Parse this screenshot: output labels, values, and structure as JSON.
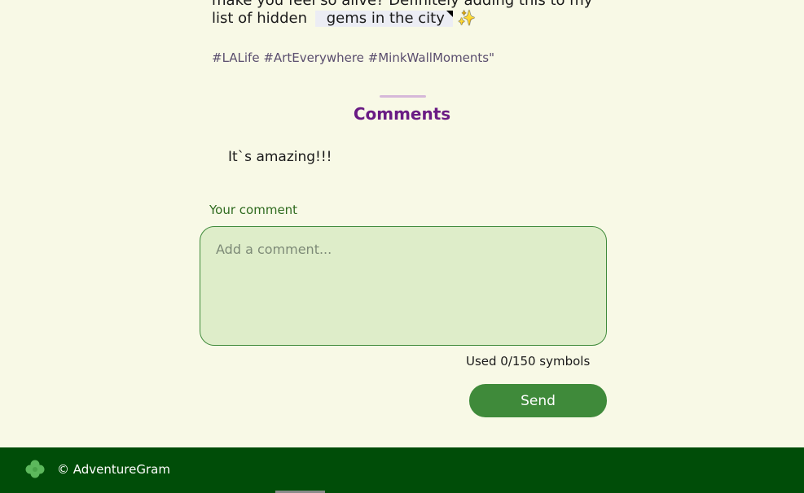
{
  "post": {
    "line1": "make you feel so alive? Definitely adding this to my",
    "line2_prefix": "list of hidden",
    "line2_highlight": "gems in the city",
    "sparkle_icon": "sparkles-icon",
    "hashtags": "#LALife #ArtEverywhere #MinkWallMoments\""
  },
  "comments": {
    "title": "Comments",
    "items": [
      {
        "text": "It`s amazing!!!"
      }
    ]
  },
  "form": {
    "label": "Your comment",
    "placeholder": "Add a comment...",
    "counter": "Used 0/150 symbols",
    "send_label": "Send"
  },
  "footer": {
    "icon": "clover-icon",
    "copyright": "© AdventureGram"
  },
  "colors": {
    "background": "#f8f9e6",
    "accent_purple": "#6a1b84",
    "accent_green": "#3f8a3a",
    "footer_green": "#004d08",
    "input_bg": "#deedc9"
  }
}
